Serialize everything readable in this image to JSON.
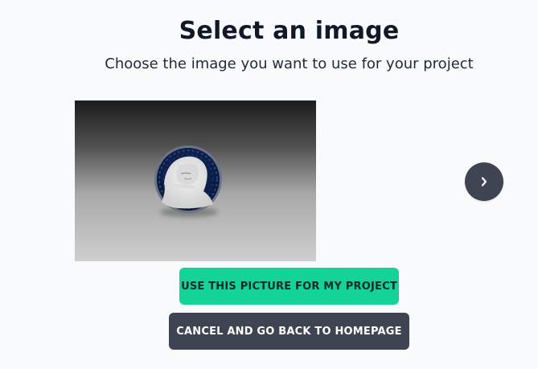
{
  "page": {
    "title": "Select an image",
    "subtitle": "Choose the image you want to use for your project"
  },
  "carousel": {
    "next_icon": "chevron-right-icon"
  },
  "actions": {
    "primary_label": "USE THIS PICTURE FOR MY PROJECT",
    "secondary_label": "CANCEL AND GO BACK TO HOMEPAGE"
  },
  "colors": {
    "background": "#f9fafb",
    "primary": "#14d396",
    "secondary": "#3f4452",
    "next_button": "#3f4452"
  }
}
